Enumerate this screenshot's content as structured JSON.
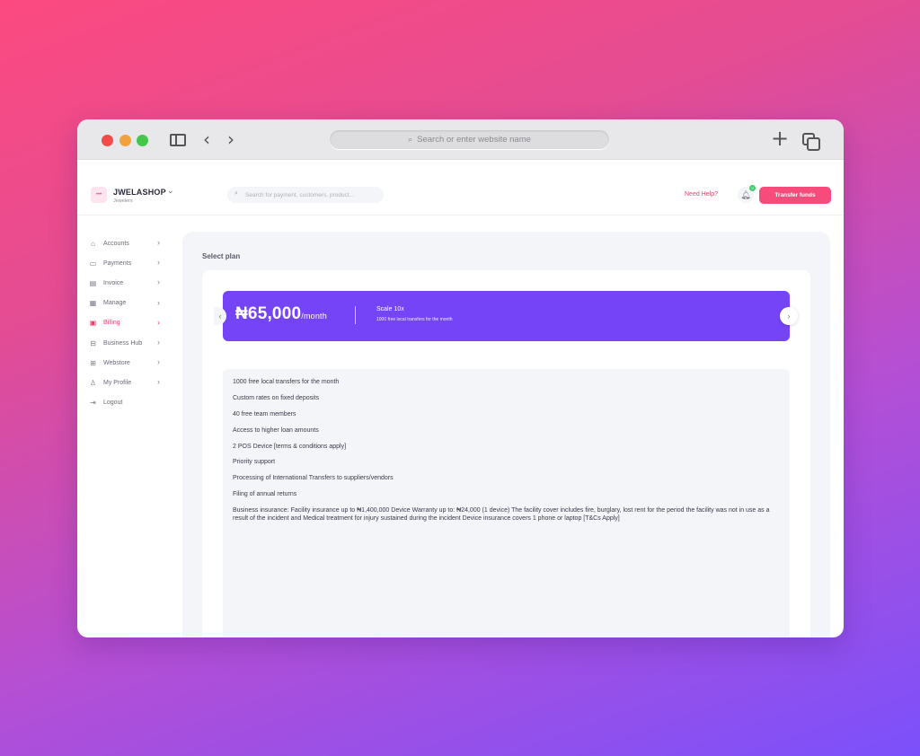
{
  "browser": {
    "url_placeholder": "Search or enter website name"
  },
  "header": {
    "logo_text": "•••",
    "shop_name": "JWELASHOP",
    "shop_type": "Jewelers",
    "search_placeholder": "Search for payment, customers, product...",
    "help_label": "Need Help?",
    "notification_count": "0",
    "transfer_label": "Transfer funds"
  },
  "sidebar": {
    "items": [
      {
        "label": "Accounts",
        "icon": "home-icon"
      },
      {
        "label": "Payments",
        "icon": "wallet-icon"
      },
      {
        "label": "Invoice",
        "icon": "receipt-icon"
      },
      {
        "label": "Manage",
        "icon": "grid-icon"
      },
      {
        "label": "Billing",
        "icon": "billing-icon",
        "active": true
      },
      {
        "label": "Business Hub",
        "icon": "briefcase-icon"
      },
      {
        "label": "Webstore",
        "icon": "store-icon"
      },
      {
        "label": "My Profile",
        "icon": "user-icon"
      },
      {
        "label": "Logout",
        "icon": "logout-icon"
      }
    ]
  },
  "main": {
    "section_title": "Select plan",
    "plan": {
      "price": "₦65,000",
      "period": "/month",
      "name": "Scale 10x",
      "description": "1000 free local transfers for the month"
    },
    "features": [
      "1000 free local transfers for the month",
      "Custom rates on fixed deposits",
      "40 free team members",
      "Access to higher loan amounts",
      "2 POS Device [terms & conditions apply]",
      "Priority support",
      "Processing of International Transfers to suppliers/vendors",
      "Filing of annual returns",
      "Business insurance: Facility insurance up to ₦1,400,000 Device Warranty up to: ₦24,000 (1 device) The facility cover includes fire, burglary, lost rent for the period the facility was not in use as a result of the incident and Medical treatment for injury sustained during the incident Device insurance covers 1 phone or laptop [T&Cs Apply]"
    ]
  },
  "colors": {
    "accent": "#f74b7b",
    "plan_bg": "#7544f7"
  }
}
